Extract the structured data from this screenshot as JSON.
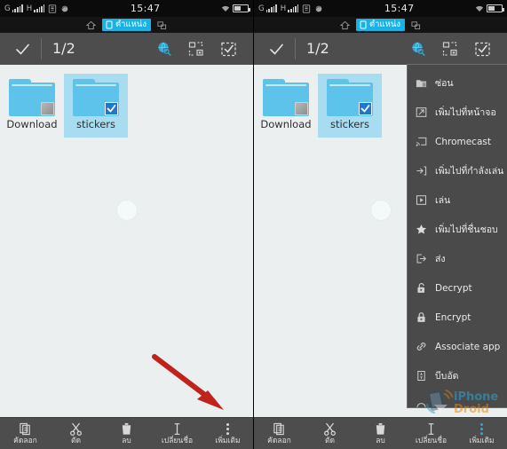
{
  "status_bar": {
    "sim1_label": "G",
    "sim2_label": "H",
    "time": "15:47",
    "icons": [
      "sim1-signal-icon",
      "sim2-signal-icon",
      "sd-card-icon",
      "sync-icon",
      "wifi-icon",
      "battery-icon"
    ]
  },
  "tab_strip": {
    "home_icon": "home-icon",
    "location_tab_label": "ตำแหน่ง",
    "location_tab_color": "#19b2e5",
    "window_icon": "multi-window-icon"
  },
  "toolbar": {
    "confirm_icon": "check-icon",
    "selection_count": "1/2",
    "search_icon": "globe-search-icon",
    "search_icon_color": "#29a8d8",
    "organize_icon": "rearrange-icon",
    "select_all_icon": "select-all-icon"
  },
  "files": [
    {
      "name": "Download",
      "type": "folder",
      "selected": false
    },
    {
      "name": "stickers",
      "type": "folder",
      "selected": true
    }
  ],
  "bottom_bar": {
    "items": [
      {
        "label": "คัดลอก",
        "icon": "copy-icon"
      },
      {
        "label": "ตัด",
        "icon": "cut-icon"
      },
      {
        "label": "ลบ",
        "icon": "delete-icon"
      },
      {
        "label": "เปลี่ยนชื่อ",
        "icon": "rename-icon"
      },
      {
        "label": "เพิ่มเติม",
        "icon": "more-icon"
      }
    ]
  },
  "popup_menu": {
    "items": [
      {
        "label": "ซ่อน",
        "icon": "hide-folder-icon"
      },
      {
        "label": "เพิ่มไปที่หน้าจอ",
        "icon": "add-to-homescreen-icon"
      },
      {
        "label": "Chromecast",
        "icon": "cast-icon"
      },
      {
        "label": "เพิ่มไปที่กำลังเล่น",
        "icon": "add-to-playing-icon"
      },
      {
        "label": "เล่น",
        "icon": "play-icon"
      },
      {
        "label": "เพิ่มไปที่ชื่นชอบ",
        "icon": "star-icon"
      },
      {
        "label": "ส่ง",
        "icon": "send-icon"
      },
      {
        "label": "Decrypt",
        "icon": "unlock-icon"
      },
      {
        "label": "Encrypt",
        "icon": "lock-icon"
      },
      {
        "label": "Associate app",
        "icon": "link-icon"
      },
      {
        "label": "บีบอัด",
        "icon": "compress-icon"
      }
    ]
  },
  "annotations": {
    "left_arrow_target": "เพิ่มเติม",
    "right_arrow_target": "ซ่อน",
    "arrow_color": "#c0231b"
  },
  "watermark": {
    "line1": "iPhone",
    "line2": "Droid"
  }
}
